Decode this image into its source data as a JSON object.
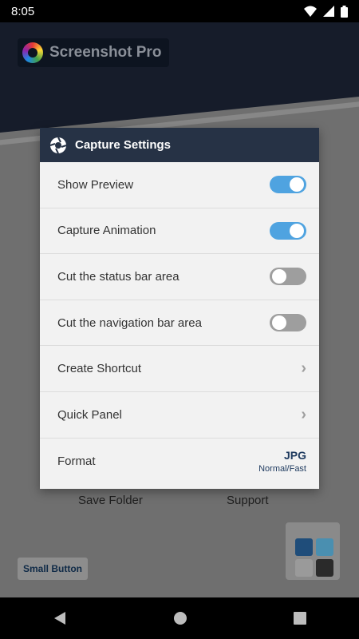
{
  "status_bar": {
    "time": "8:05"
  },
  "app": {
    "title": "Screenshot Pro"
  },
  "background": {
    "save_folder": "Save Folder",
    "support": "Support",
    "small_button": "Small Button"
  },
  "dialog": {
    "title": "Capture Settings",
    "rows": [
      {
        "label": "Show Preview",
        "control": "toggle",
        "on": true
      },
      {
        "label": "Capture Animation",
        "control": "toggle",
        "on": true
      },
      {
        "label": "Cut the status bar area",
        "control": "toggle",
        "on": false
      },
      {
        "label": "Cut the navigation bar area",
        "control": "toggle",
        "on": false
      },
      {
        "label": "Create Shortcut",
        "control": "chevron"
      },
      {
        "label": "Quick Panel",
        "control": "chevron"
      },
      {
        "label": "Format",
        "control": "value",
        "value": "JPG",
        "sub_value": "Normal/Fast"
      }
    ]
  },
  "colors": {
    "toggle_on": "#4fa3e0",
    "toggle_off": "#9e9e9e",
    "dialog_header": "#263245"
  }
}
